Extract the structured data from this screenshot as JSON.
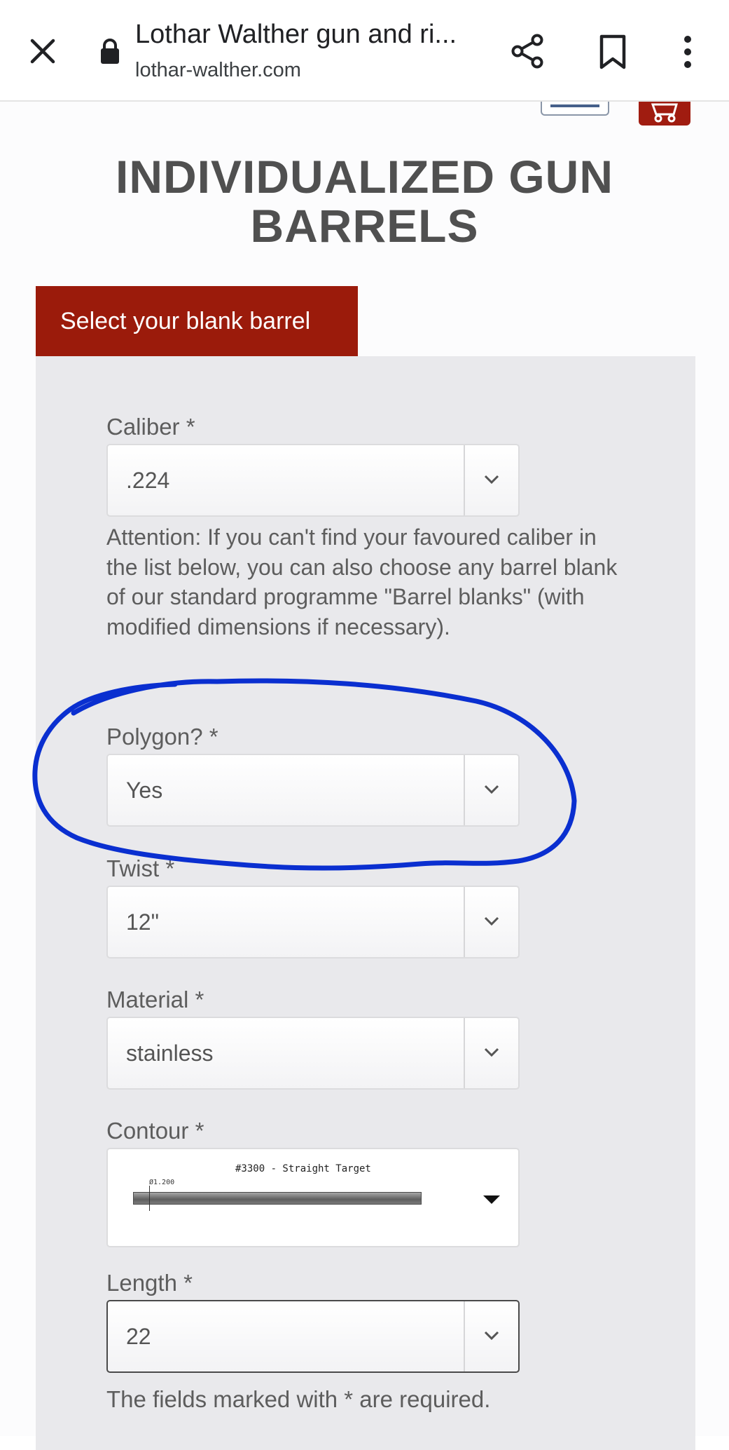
{
  "browser": {
    "title": "Lothar Walther gun and ri...",
    "url": "lothar-walther.com",
    "icons": [
      "close-icon",
      "lock-icon",
      "share-icon",
      "bookmark-icon",
      "more-vert-icon"
    ]
  },
  "page": {
    "heading_line1": "INDIVIDUALIZED GUN",
    "heading_line2": "BARRELS",
    "tab_label": "Select your blank barrel",
    "accent_color": "#9b1b0b",
    "annotation_color": "#0a2fd0"
  },
  "form": {
    "caliber": {
      "label": "Caliber *",
      "value": ".224"
    },
    "attention": "Attention: If you can't find your favoured caliber in the list below, you can also choose any barrel blank of our standard programme \"Barrel blanks\" (with modified dimensions if necessary).",
    "polygon": {
      "label": "Polygon? *",
      "value": "Yes"
    },
    "twist": {
      "label": "Twist *",
      "value": "12\""
    },
    "material": {
      "label": "Material *",
      "value": "stainless"
    },
    "contour": {
      "label": "Contour *",
      "image_title": "#3300 - Straight Target",
      "diameter": "Ø1.200"
    },
    "length": {
      "label": "Length *",
      "value": "22"
    },
    "required_note": "The fields marked with * are required."
  }
}
